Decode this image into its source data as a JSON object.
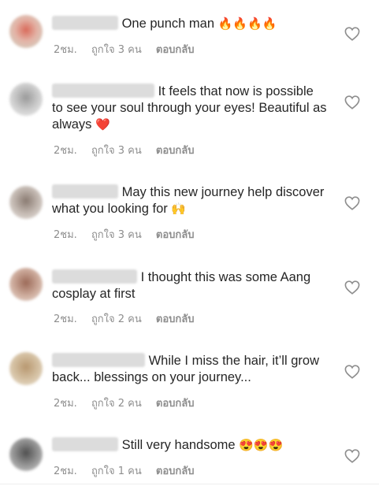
{
  "comments": [
    {
      "text": "One punch man",
      "emoji": "🔥🔥🔥🔥",
      "time": "2ชม.",
      "likes": "ถูกใจ 3 คน",
      "reply": "ตอบกลับ",
      "avatar_color": "#d4a59a"
    },
    {
      "text": "It feels that now is possible to see your soul through your eyes! Beautiful as always",
      "emoji": "❤️",
      "time": "2ชม.",
      "likes": "ถูกใจ 3 คน",
      "reply": "ตอบกลับ",
      "avatar_color": "#b8b8b8"
    },
    {
      "text": "May this new journey help discover what you looking for",
      "emoji": "🙌",
      "time": "2ชม.",
      "likes": "ถูกใจ 3 คน",
      "reply": "ตอบกลับ",
      "avatar_color": "#a89890"
    },
    {
      "text": "I thought this was some Aang cosplay at first",
      "emoji": "",
      "time": "2ชม.",
      "likes": "ถูกใจ 2 คน",
      "reply": "ตอบกลับ",
      "avatar_color": "#b09080"
    },
    {
      "text": "While I miss the hair, it’ll grow back... blessings on your journey...",
      "emoji": "",
      "time": "2ชม.",
      "likes": "ถูกใจ 2 คน",
      "reply": "ตอบกลับ",
      "avatar_color": "#c0a880"
    },
    {
      "text": "Still very handsome",
      "emoji": "😍😍😍",
      "time": "2ชม.",
      "likes": "ถูกใจ 1 คน",
      "reply": "ตอบกลับ",
      "avatar_color": "#707070"
    }
  ]
}
